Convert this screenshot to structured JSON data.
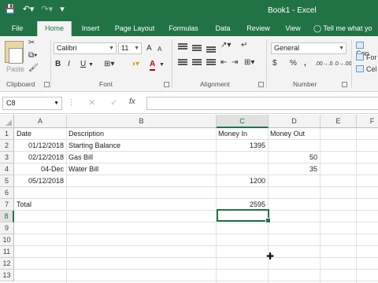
{
  "titlebar": {
    "save_icon": "save-icon",
    "undo_icon": "undo-icon",
    "redo_icon": "redo-icon",
    "customize_icon": "customize-qat-icon",
    "title": "Book1 - Excel",
    "colors": {
      "brand": "#217346"
    }
  },
  "tabs": [
    "File",
    "Home",
    "Insert",
    "Page Layout",
    "Formulas",
    "Data",
    "Review",
    "View"
  ],
  "tell_me": "Tell me what yo",
  "ribbon": {
    "clipboard": {
      "paste": "Paste",
      "label": "Clipboard"
    },
    "font": {
      "name": "Calibri",
      "size": "11",
      "bold": "B",
      "italic": "I",
      "underline": "U",
      "grow": "A",
      "shrink": "A",
      "color_letter": "A",
      "label": "Font"
    },
    "alignment": {
      "label": "Alignment"
    },
    "number": {
      "format": "General",
      "currency": "$",
      "percent": "%",
      "comma": ",",
      "inc_decimal": ".00→.0",
      "dec_decimal": ".0→.00",
      "label": "Number"
    },
    "styles": {
      "items": [
        "Con",
        "For",
        "Cel"
      ]
    }
  },
  "formula_bar": {
    "name_box": "C8",
    "fx": "fx",
    "cancel": "✕",
    "enter": "✓",
    "value": ""
  },
  "sheet": {
    "columns": [
      "A",
      "B",
      "C",
      "D",
      "E",
      "F"
    ],
    "selected_column": "C",
    "rows": [
      "1",
      "2",
      "3",
      "4",
      "5",
      "6",
      "7",
      "8",
      "9",
      "10",
      "11",
      "12",
      "13"
    ],
    "selected_row": "8",
    "cells": {
      "A1": "Date",
      "B1": "Description",
      "C1": "Money In",
      "D1": "Money Out",
      "A2": "01/12/2018",
      "B2": "Starting Balance",
      "C2": "1395",
      "A3": "02/12/2018",
      "B3": "Gas Bill",
      "D3": "50",
      "A4": "04-Dec",
      "B4": "Water Bill",
      "D4": "35",
      "A5": "05/12/2018",
      "C5": "1200",
      "A7": "Total",
      "C7": "2595"
    }
  }
}
